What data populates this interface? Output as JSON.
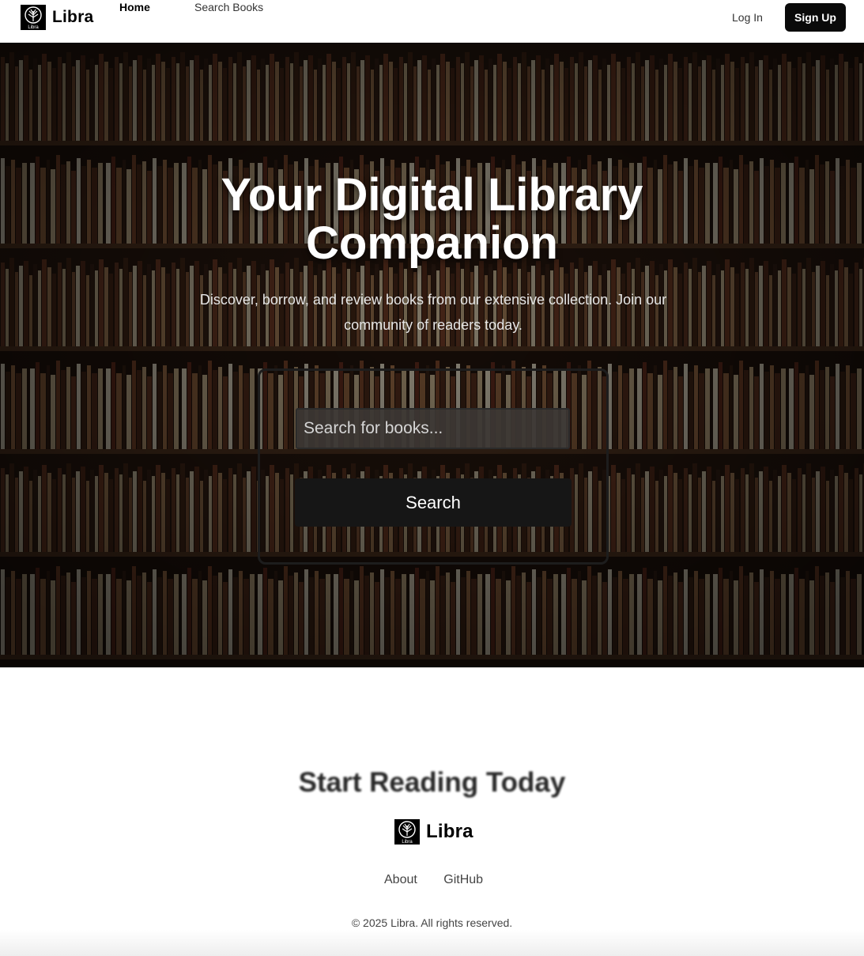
{
  "header": {
    "brand": "Libra",
    "logo_text": "Libra",
    "nav": [
      "Home",
      "Search Books"
    ],
    "login_label": "Log In",
    "signup_label": "Sign Up"
  },
  "hero": {
    "title_line1": "Your Digital Library",
    "title_line2": "Companion",
    "subtitle": "Discover, borrow, and review books from our extensive collection. Join our community of readers today.",
    "search_placeholder": "Search for books...",
    "search_button": "Search"
  },
  "cta": {
    "heading": "Start Reading Today"
  },
  "footer": {
    "brand": "Libra",
    "links": [
      "About",
      "GitHub"
    ],
    "copyright": "© 2025 Libra. All rights reserved."
  },
  "colors": {
    "primary": "#0a0a0a",
    "hero_overlay": "#1a0f0a",
    "text_muted": "#444444"
  },
  "icons": [
    "libra-logo-icon",
    "bookshelf-background-image"
  ]
}
